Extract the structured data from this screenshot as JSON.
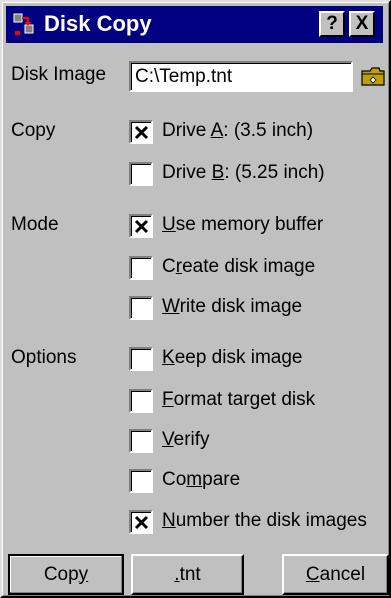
{
  "title": "Disk Copy",
  "title_buttons": {
    "help": "?",
    "close": "X"
  },
  "disk_image": {
    "label": "Disk Image",
    "value": "C:\\Temp.tnt"
  },
  "sections": {
    "copy": "Copy",
    "mode": "Mode",
    "options": "Options"
  },
  "copy_options": [
    {
      "pre": "Drive ",
      "key": "A",
      "post": ": (3.5 inch)",
      "checked": true
    },
    {
      "pre": "Drive ",
      "key": "B",
      "post": ": (5.25 inch)",
      "checked": false
    }
  ],
  "mode_options": [
    {
      "pre": "",
      "key": "U",
      "post": "se memory buffer",
      "checked": true
    },
    {
      "pre": "C",
      "key": "r",
      "post": "eate disk image",
      "checked": false
    },
    {
      "pre": "",
      "key": "W",
      "post": "rite disk image",
      "checked": false
    }
  ],
  "option_items": [
    {
      "pre": "",
      "key": "K",
      "post": "eep disk image",
      "checked": false
    },
    {
      "pre": "",
      "key": "F",
      "post": "ormat target disk",
      "checked": false
    },
    {
      "pre": "",
      "key": "V",
      "post": "erify",
      "checked": false
    },
    {
      "pre": "Co",
      "key": "m",
      "post": "pare",
      "checked": false
    },
    {
      "pre": "",
      "key": "N",
      "post": "umber the disk images",
      "checked": true
    }
  ],
  "buttons": {
    "copy": {
      "pre": "Cop",
      "key": "y",
      "post": ""
    },
    "tnt": {
      "pre": "",
      "key": ".",
      "post": "tnt"
    },
    "cancel": {
      "pre": "",
      "key": "C",
      "post": "ancel"
    }
  },
  "colors": {
    "titlebar": "#000080",
    "face": "#c0c0c0"
  }
}
